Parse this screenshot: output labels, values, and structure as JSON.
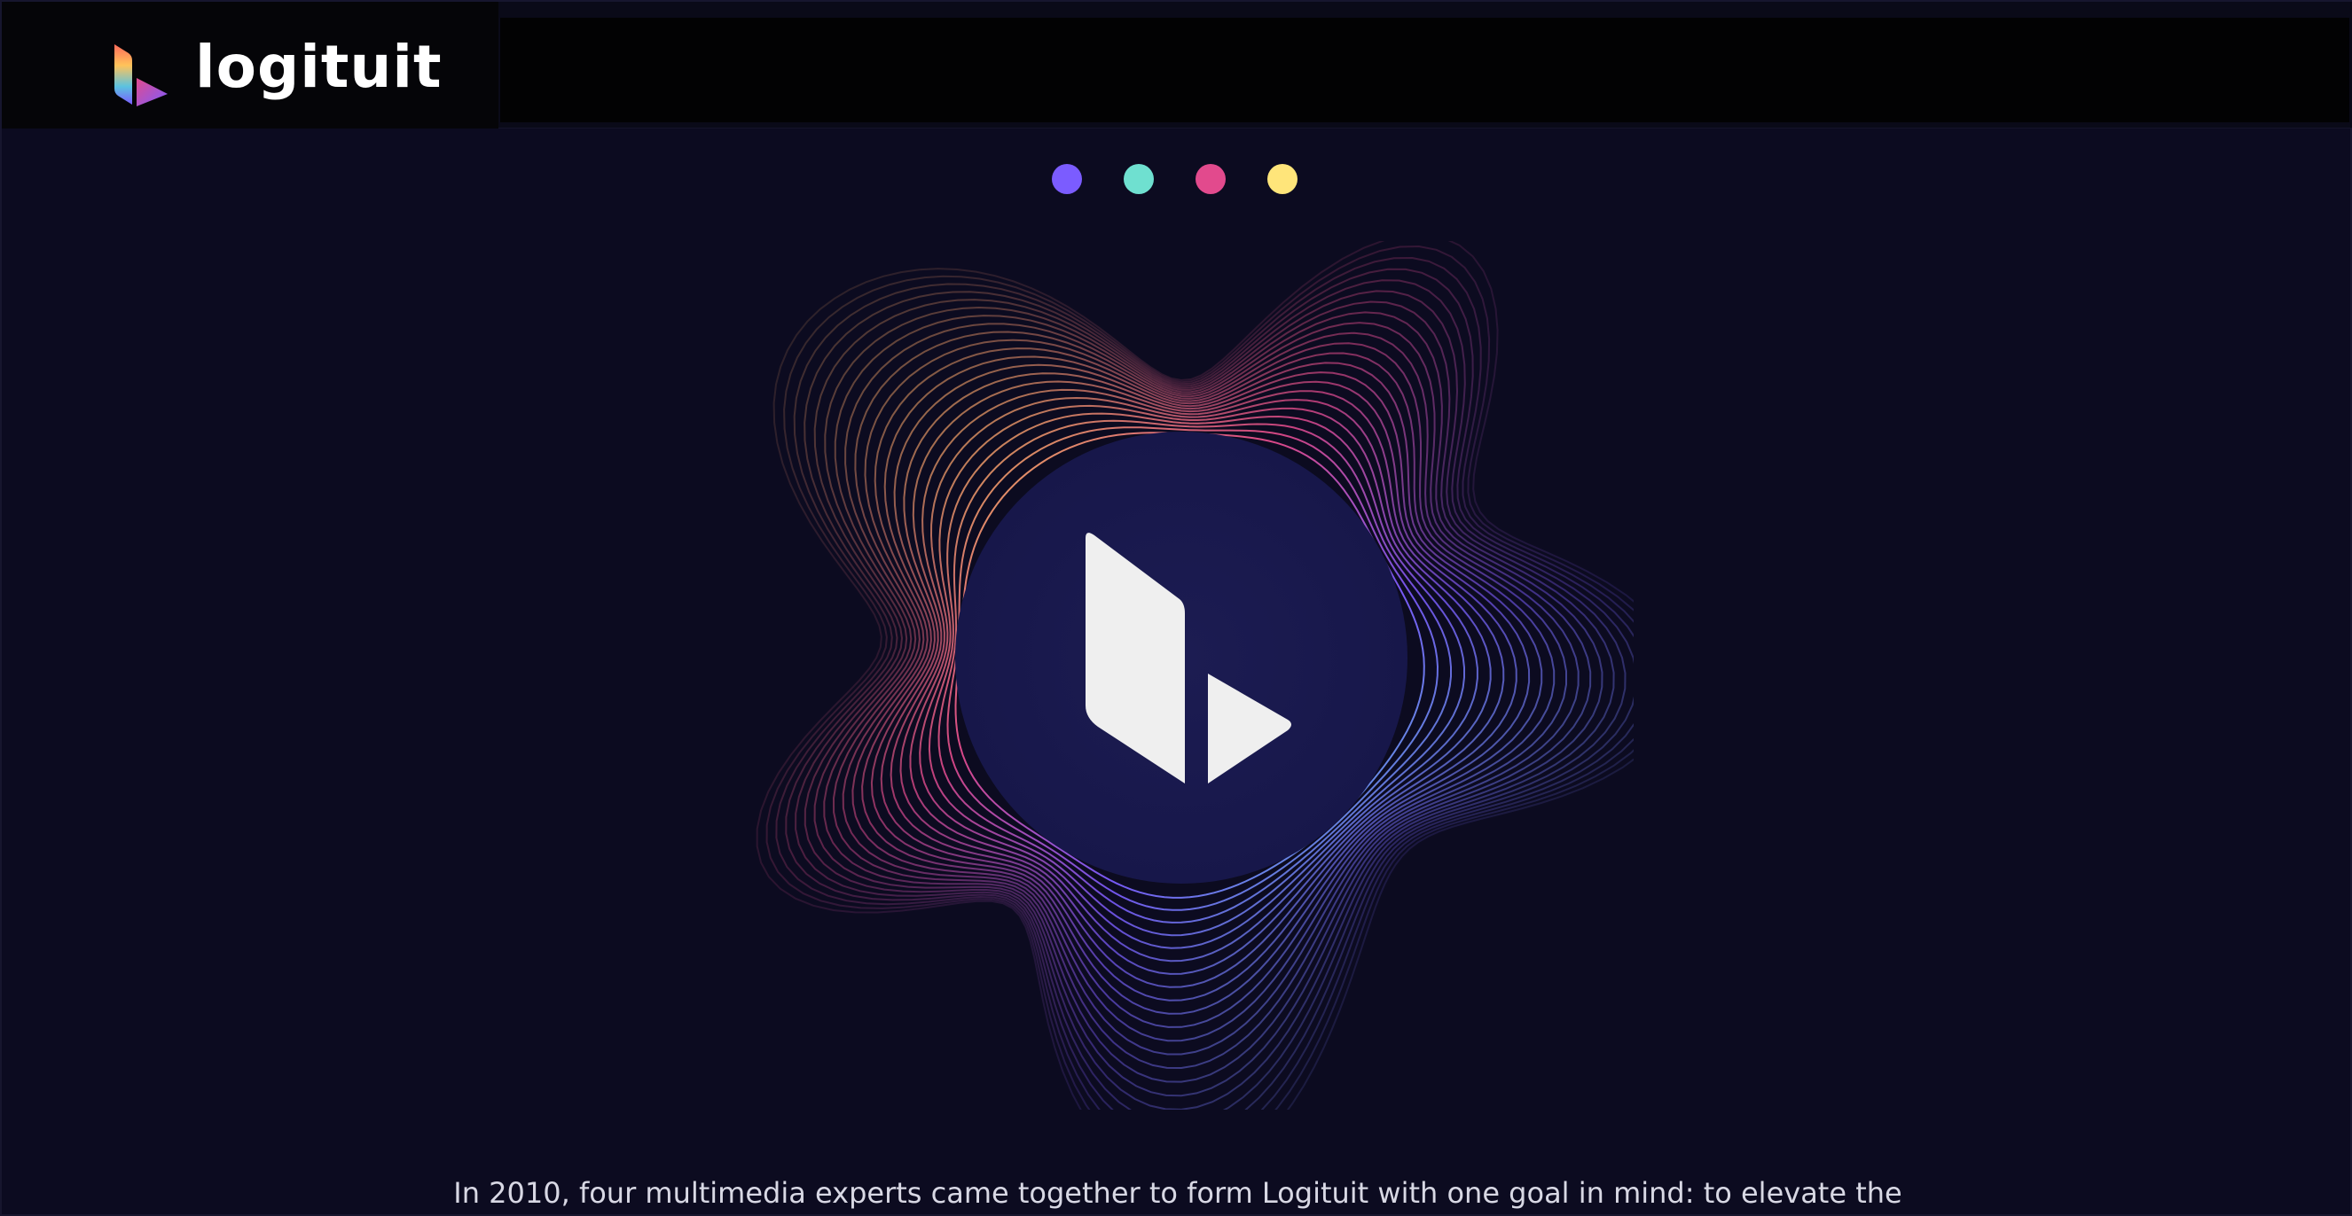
{
  "brand": {
    "name": "logituit",
    "logo_icon": "logituit-logo-icon"
  },
  "carousel": {
    "dots": [
      {
        "name": "dot-purple",
        "color": "#7b5cff"
      },
      {
        "name": "dot-teal",
        "color": "#6fe0d0"
      },
      {
        "name": "dot-pink",
        "color": "#e24a8d"
      },
      {
        "name": "dot-yellow",
        "color": "#ffe57a"
      }
    ]
  },
  "hero": {
    "emblem_icon": "logituit-emblem-icon",
    "colors": {
      "circle": "#1a1a4a",
      "waves": [
        "#f2b85a",
        "#e24a8d",
        "#7b5cff",
        "#5bc3e0",
        "#d85ab0"
      ]
    }
  },
  "intro": {
    "text": "In 2010, four multimedia experts came together to form Logituit with one goal in mind: to elevate the"
  }
}
